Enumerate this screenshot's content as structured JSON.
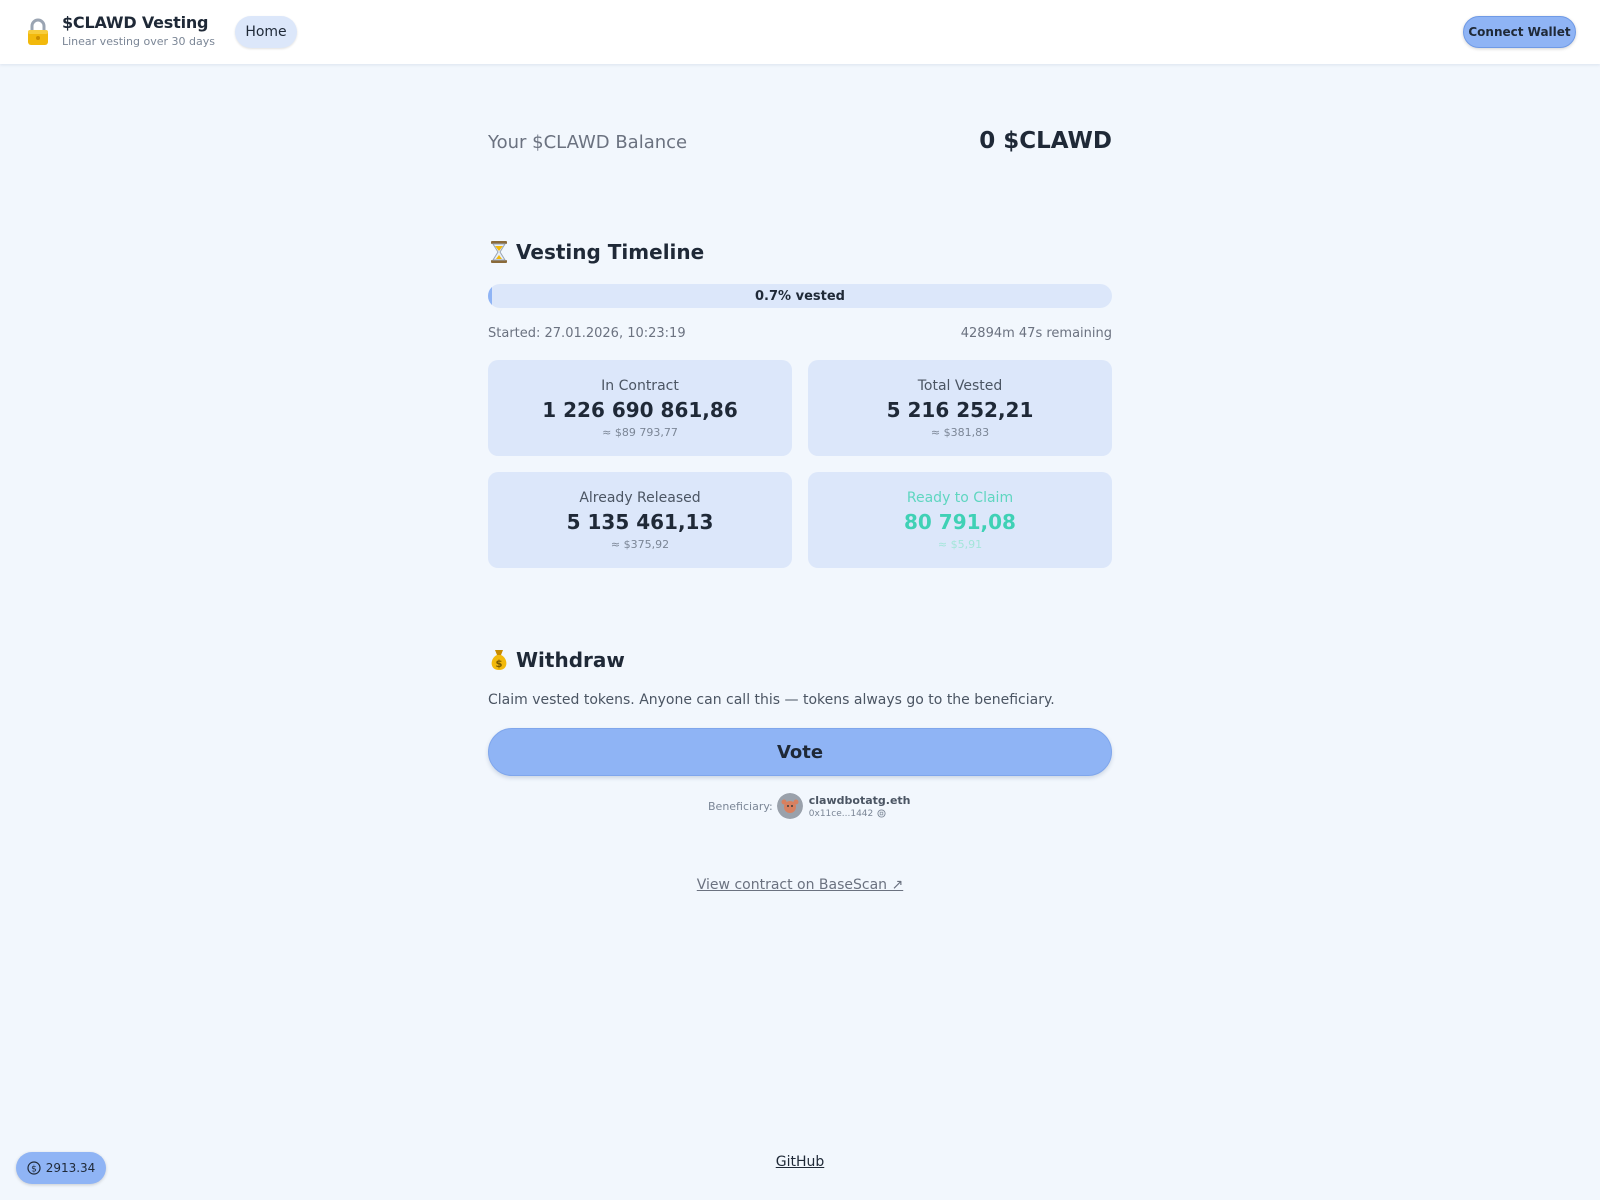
{
  "header": {
    "title": "$CLAWD Vesting",
    "subtitle": "Linear vesting over 30 days",
    "home_label": "Home",
    "connect_label": "Connect Wallet"
  },
  "balance": {
    "label": "Your $CLAWD Balance",
    "value": "0 $CLAWD"
  },
  "timeline": {
    "title": "Vesting Timeline",
    "progress_label": "0.7% vested",
    "progress_fraction": 0.007,
    "started": "Started: 27.01.2026, 10:23:19",
    "remaining": "42894m 47s remaining"
  },
  "cards": [
    {
      "label": "In Contract",
      "value": "1 226 690 861,86",
      "usd": "≈ $89 793,77"
    },
    {
      "label": "Total Vested",
      "value": "5 216 252,21",
      "usd": "≈ $381,83"
    },
    {
      "label": "Already Released",
      "value": "5 135 461,13",
      "usd": "≈ $375,92"
    },
    {
      "label": "Ready to Claim",
      "value": "80 791,08",
      "usd": "≈ $5,91"
    }
  ],
  "withdraw": {
    "title": "Withdraw",
    "description": "Claim vested tokens. Anyone can call this — tokens always go to the beneficiary.",
    "vote_label": "Vote",
    "beneficiary_label": "Beneficiary:",
    "beneficiary_name": "clawdbotatg.eth",
    "beneficiary_addr": "0x11ce...1442"
  },
  "links": {
    "basescan": "View contract on BaseScan ↗",
    "github": "GitHub"
  },
  "price": {
    "value": "2913.34"
  },
  "colors": {
    "accent": "#8fb4f5",
    "card_bg": "#dce7fa",
    "claim": "#3fd1b5",
    "page_bg": "#f2f7fd"
  }
}
